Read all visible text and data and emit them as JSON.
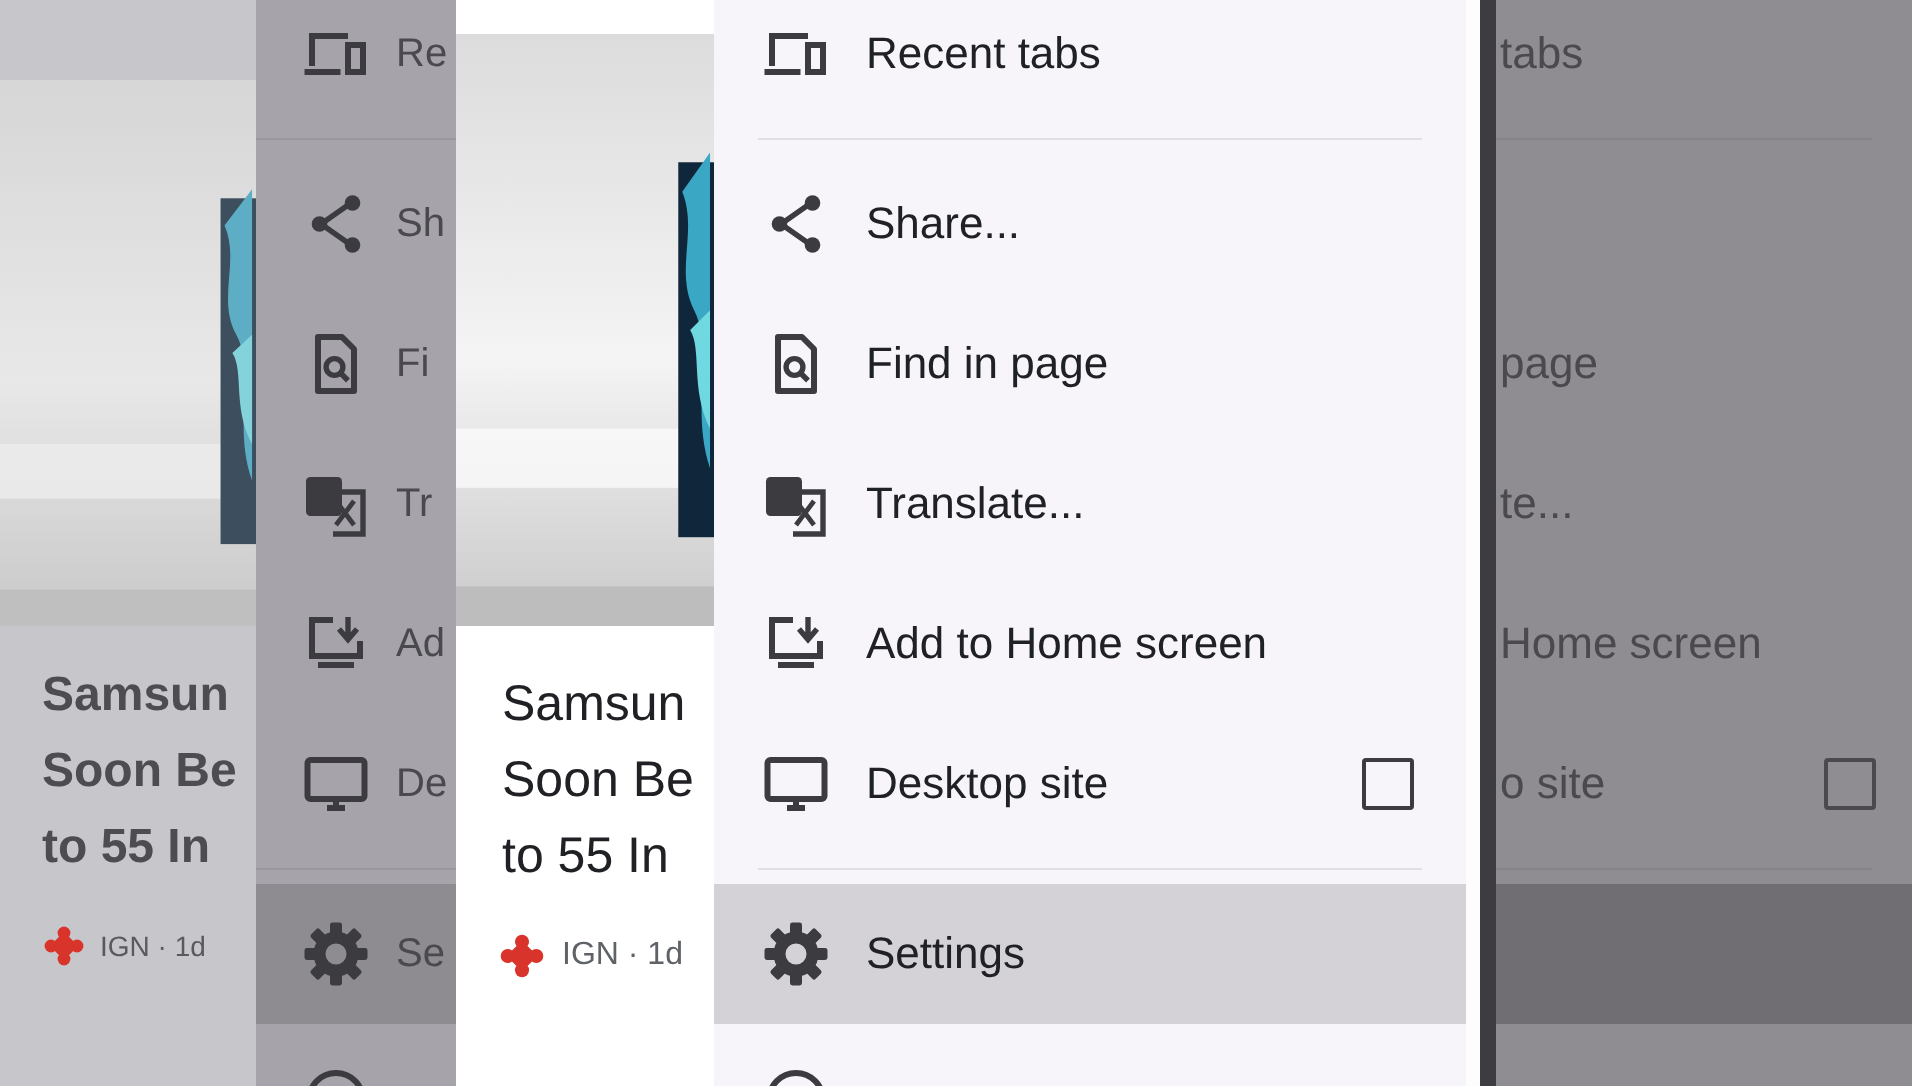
{
  "article_card": {
    "kind": "picture",
    "title_lines": [
      "Samsun",
      "Soon Be",
      "to 55 In"
    ],
    "source": "IGN · 1d"
  },
  "blurred_article_card": {
    "kind": "picture",
    "title_lines": [
      "Samsun",
      "Soon Be",
      "to 55 In"
    ],
    "source": "IGN · 1d"
  },
  "menu": {
    "items": [
      {
        "kind": "item",
        "label": "Recent tabs",
        "selected": false,
        "blurred_left": "Re",
        "blurred_right": "tabs",
        "divider_after": true
      },
      {
        "kind": "item",
        "label": "Share...",
        "selected": false,
        "blurred_left": "Sh"
      },
      {
        "kind": "item",
        "label": "Find in page",
        "selected": false,
        "blurred_left": "Fi",
        "blurred_right": "page"
      },
      {
        "kind": "item",
        "label": "Translate...",
        "selected": false,
        "blurred_left": "Tr",
        "blurred_right": "te..."
      },
      {
        "kind": "item",
        "label": "Add to Home screen",
        "selected": false,
        "blurred_left": "Ad",
        "blurred_right": "Home screen"
      },
      {
        "kind": "checkbox",
        "label": "Desktop site",
        "checked": false,
        "selected": false,
        "blurred_left": "De",
        "blurred_right": "o site",
        "divider_after": true
      },
      {
        "kind": "item",
        "label": "Settings",
        "selected": true,
        "blurred_left": "Se"
      },
      {
        "kind": "partial",
        "selected": false
      }
    ]
  }
}
